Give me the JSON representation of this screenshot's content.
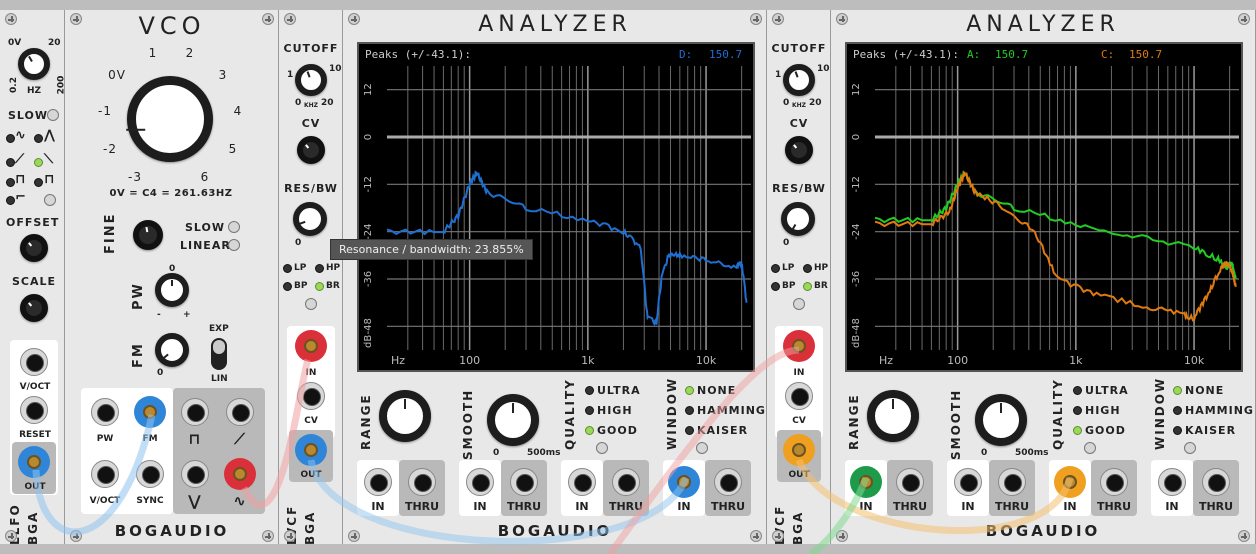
{
  "llfo": {
    "freq_scale": [
      "0V",
      "20",
      "0.2",
      "200"
    ],
    "freq_unit": "HZ",
    "slow_label": "SLOW",
    "offset_label": "OFFSET",
    "scale_label": "SCALE",
    "voct_label": "V/OCT",
    "reset_label": "RESET",
    "out_label": "OUT",
    "module_name": "LLFO",
    "brand_short": "BGA"
  },
  "vco": {
    "title": "VCO",
    "freq_marks": [
      "0V",
      "1",
      "2",
      "3",
      "4",
      "5",
      "6",
      "-3",
      "-2",
      "-1"
    ],
    "freq_note": "0V = C4 = 261.63HZ",
    "fine_label": "FINE",
    "slow_label": "SLOW",
    "linear_label": "LINEAR",
    "pw_label": "PW",
    "fm_label": "FM",
    "exp_label": "EXP",
    "lin_label": "LIN",
    "pw_scale": [
      "0",
      "-",
      "+"
    ],
    "fm_scale": "0",
    "jack_labels": [
      "PW",
      "FM",
      "V/OCT",
      "SYNC"
    ],
    "brand": "BOGAUDIO"
  },
  "lvcf1": {
    "cutoff_label": "CUTOFF",
    "cutoff_scale": [
      "1",
      "10",
      "0",
      "20"
    ],
    "cutoff_unit": "KHZ",
    "cv_label": "CV",
    "res_label": "RES/BW",
    "res_scale": "0",
    "modes": [
      "LP",
      "HP",
      "BP",
      "BR"
    ],
    "in_label": "IN",
    "cv_jack_label": "CV",
    "out_label": "OUT",
    "module_name": "LVCF",
    "brand_short": "BGA"
  },
  "analyzer1": {
    "title": "ANALYZER",
    "peaks_label": "Peaks (+/-43.1):",
    "channel_label": "D:",
    "channel_value": "150.7",
    "db_ticks": [
      "12",
      "0",
      "-12",
      "-24",
      "-36",
      "-48",
      "dB"
    ],
    "freq_ticks": [
      "Hz",
      "100",
      "1k",
      "10k"
    ],
    "range_label": "RANGE",
    "smooth_label": "SMOOTH",
    "smooth_scale": [
      "0",
      "500ms"
    ],
    "quality_label": "QUALITY",
    "quality_opts": [
      "ULTRA",
      "HIGH",
      "GOOD"
    ],
    "window_label": "WINDOW",
    "window_opts": [
      "NONE",
      "HAMMING",
      "KAISER"
    ],
    "io_labels": [
      "IN",
      "THRU",
      "IN",
      "THRU",
      "IN",
      "THRU",
      "IN",
      "THRU"
    ],
    "brand": "BOGAUDIO"
  },
  "lvcf2": {
    "cutoff_label": "CUTOFF",
    "cutoff_scale": [
      "1",
      "10",
      "0",
      "20"
    ],
    "cutoff_unit": "KHZ",
    "cv_label": "CV",
    "res_label": "RES/BW",
    "res_scale": "0",
    "modes": [
      "LP",
      "HP",
      "BP",
      "BR"
    ],
    "in_label": "IN",
    "cv_jack_label": "CV",
    "out_label": "OUT",
    "module_name": "LVCF",
    "brand_short": "BGA"
  },
  "analyzer2": {
    "title": "ANALYZER",
    "peaks_label": "Peaks (+/-43.1):",
    "a_label": "A:",
    "a_value": "150.7",
    "c_label": "C:",
    "c_value": "150.7",
    "db_ticks": [
      "12",
      "0",
      "-12",
      "-24",
      "-36",
      "-48",
      "dB"
    ],
    "freq_ticks": [
      "Hz",
      "100",
      "1k",
      "10k"
    ],
    "range_label": "RANGE",
    "smooth_label": "SMOOTH",
    "smooth_scale": [
      "0",
      "500ms"
    ],
    "quality_label": "QUALITY",
    "quality_opts": [
      "ULTRA",
      "HIGH",
      "GOOD"
    ],
    "window_label": "WINDOW",
    "window_opts": [
      "NONE",
      "HAMMING",
      "KAISER"
    ],
    "io_labels": [
      "IN",
      "THRU",
      "IN",
      "THRU",
      "IN",
      "THRU",
      "IN",
      "THRU"
    ],
    "brand": "BOGAUDIO"
  },
  "tooltip": "Resonance / bandwidth: 23.855%",
  "colors": {
    "trace_d": "#1f6fd1",
    "trace_a": "#22cc22",
    "trace_c": "#e07a10",
    "plug_red": "#d9303a",
    "plug_blue": "#2f86d8",
    "plug_green": "#1d9a4a",
    "plug_orange": "#f0a020"
  }
}
